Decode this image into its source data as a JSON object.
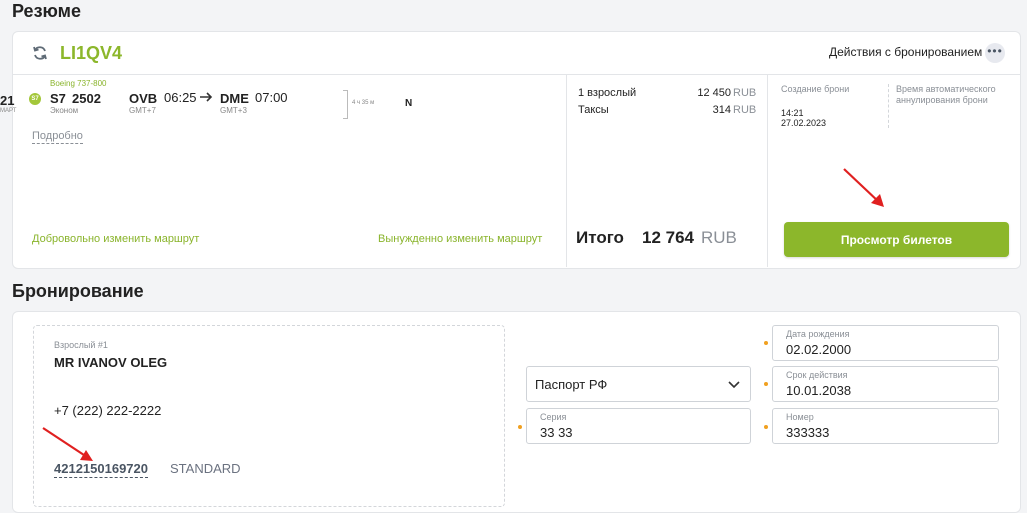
{
  "summary": {
    "section_title": "Резюме",
    "pnr": "LI1QV4",
    "actions_label": "Действия с бронированием",
    "more_icon": "more-dots-icon",
    "refresh_icon": "refresh-icon",
    "flight": {
      "date_partial": "21",
      "month_partial": "МАРТ",
      "aircraft": "Boeing 737-800",
      "airline_badge": "S7",
      "airline_code": "S7",
      "flight_number": "2502",
      "cabin": "Эконом",
      "from_code": "OVB",
      "from_tz": "GMT+7",
      "dep_time": "06:25",
      "to_code": "DME",
      "to_tz": "GMT+3",
      "arr_time": "07:00",
      "duration": "4 ч 35 м",
      "fare_class": "N",
      "details_link": "Подробно"
    },
    "voluntary_change": "Добровольно изменить маршрут",
    "forced_change": "Вынужденно изменить маршрут",
    "pricing": {
      "rows": [
        {
          "label": "1 взрослый",
          "amount": "12 450",
          "currency": "RUB"
        },
        {
          "label": "Таксы",
          "amount": "314",
          "currency": "RUB"
        }
      ],
      "total_label": "Итого",
      "total_amount": "12 764",
      "total_currency": "RUB"
    },
    "booking_info": {
      "created_label": "Создание брони",
      "created_time": "14:21",
      "created_date": "27.02.2023",
      "auto_cancel_label_1": "Время автоматического",
      "auto_cancel_label_2": "аннулирования брони"
    },
    "view_tickets_button": "Просмотр билетов"
  },
  "booking": {
    "section_title": "Бронирование",
    "passenger": {
      "type_label": "Взрослый #1",
      "name": "MR IVANOV OLEG",
      "phone": "+7 (222) 222-2222",
      "ticket_number": "4212150169720",
      "ticket_type": "STANDARD"
    },
    "document": {
      "doc_type": "Паспорт РФ",
      "series_label": "Серия",
      "series_value": "33 33",
      "birth_label": "Дата рождения",
      "birth_value": "02.02.2000",
      "expiry_label": "Срок действия",
      "expiry_value": "10.01.2038",
      "number_label": "Номер",
      "number_value": "333333"
    }
  },
  "colors": {
    "accent_green": "#8cb72b",
    "arrow_red": "#e02020",
    "required_dot": "#f0a020"
  }
}
